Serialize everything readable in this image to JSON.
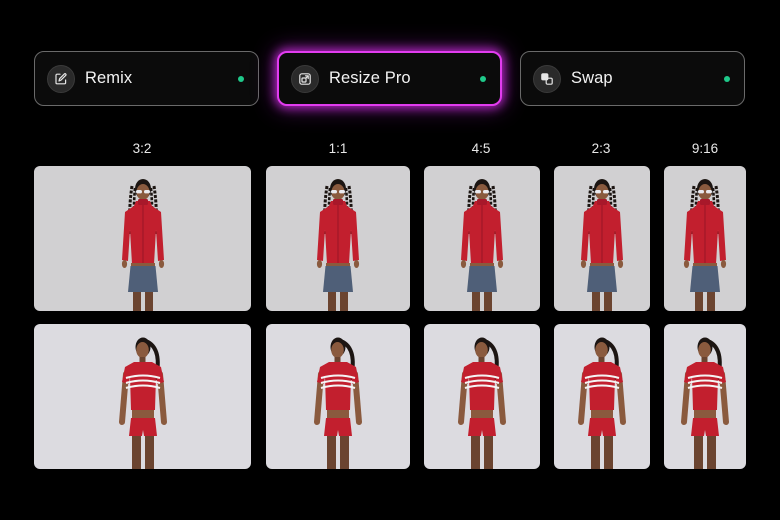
{
  "tools": [
    {
      "label": "Remix",
      "icon": "edit-sparkle-icon",
      "status_color": "#1fc98a"
    },
    {
      "label": "Resize Pro",
      "icon": "resize-icon",
      "status_color": "#1fc98a",
      "active": true
    },
    {
      "label": "Swap",
      "icon": "swap-icon",
      "status_color": "#1fc98a"
    }
  ],
  "aspect_ratios": [
    "3:2",
    "1:1",
    "4:5",
    "2:3",
    "9:16"
  ],
  "rows": [
    {
      "subject": "model-red-jacket-denim-skirt",
      "background": "#d1d0d2"
    },
    {
      "subject": "model-red-striped-tee-shorts",
      "background": "#dcdbe0"
    }
  ],
  "colors": {
    "accent_glow": "#e23cf0",
    "status_green": "#1fc98a",
    "garment_red": "#c21f2e",
    "denim": "#4f5f78"
  }
}
